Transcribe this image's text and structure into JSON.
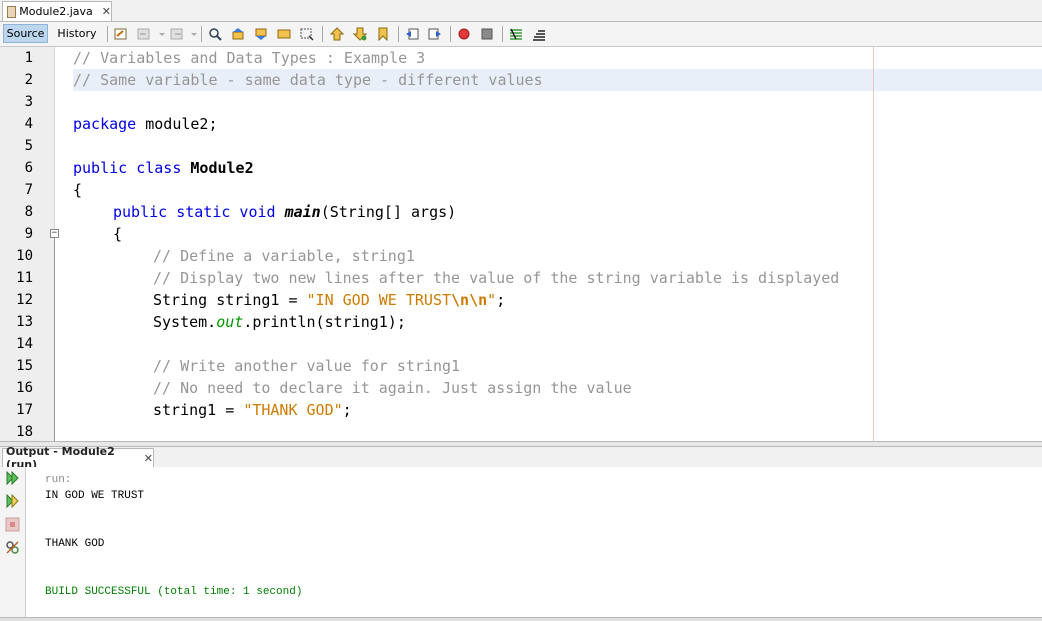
{
  "editor_tab": {
    "title": "Module2.java",
    "close": "✕"
  },
  "toolbar": {
    "source_label": "Source",
    "history_label": "History"
  },
  "lines": [
    {
      "num": "1"
    },
    {
      "num": "2"
    },
    {
      "num": "3"
    },
    {
      "num": "4"
    },
    {
      "num": "5"
    },
    {
      "num": "6"
    },
    {
      "num": "7"
    },
    {
      "num": "8"
    },
    {
      "num": "9"
    },
    {
      "num": "10"
    },
    {
      "num": "11"
    },
    {
      "num": "12"
    },
    {
      "num": "13"
    },
    {
      "num": "14"
    },
    {
      "num": "15"
    },
    {
      "num": "16"
    },
    {
      "num": "17"
    },
    {
      "num": "18"
    }
  ],
  "code": {
    "l1": "// Variables and Data Types : Example 3",
    "l2": "// Same variable - same data type - different values",
    "l4_kw": "package",
    "l4_rest": " module2;",
    "l6_kw": "public class",
    "l6_cls": "Module2",
    "l7": "{",
    "l8_kw": "public static void",
    "l8_mth": "main",
    "l8_rest": "(String[] args)",
    "l9": "{",
    "l10": "// Define a variable, string1",
    "l11": "// Display two new lines after the value of the string variable is displayed",
    "l12_a": "String string1 = ",
    "l12_str": "\"IN GOD WE TRUST",
    "l12_esc": "\\n\\n",
    "l12_q": "\"",
    "l12_end": ";",
    "l13_a": "System.",
    "l13_fld": "out",
    "l13_b": ".println(string1);",
    "l15": "// Write another value for string1",
    "l16": "// No need to declare it again. Just assign the value",
    "l17_a": "string1 = ",
    "l17_str": "\"THANK GOD\"",
    "l17_end": ";"
  },
  "output": {
    "tab_title": "Output - Module2 (run)",
    "close": "✕",
    "lines": [
      "run:",
      "IN GOD WE TRUST",
      "THANK GOD",
      "BUILD SUCCESSFUL (total time: 1 second)"
    ]
  },
  "colors": {
    "keyword": "#0000e6",
    "comment": "#969696",
    "string": "#ce7b00",
    "success": "#008000",
    "field": "#009900"
  }
}
